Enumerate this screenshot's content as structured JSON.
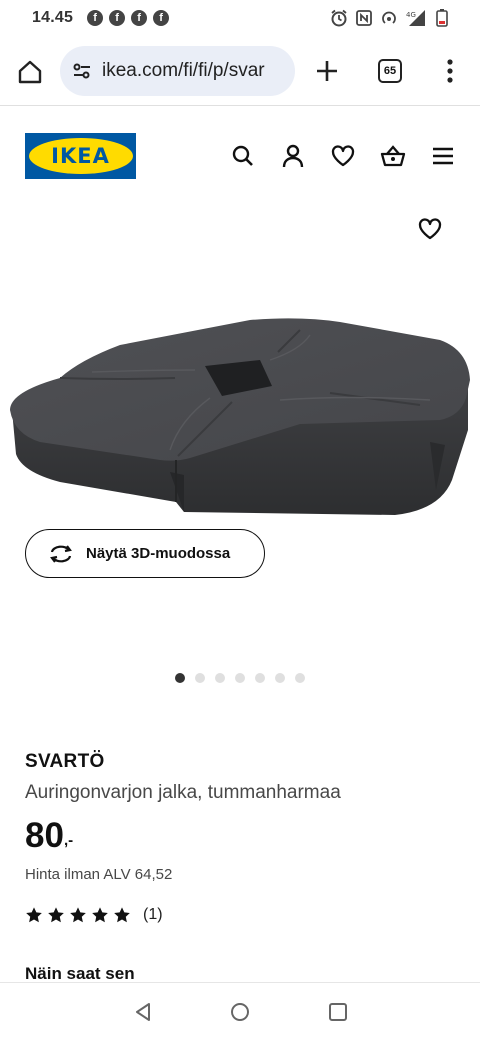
{
  "status_bar": {
    "time": "14.45",
    "notification_icons": [
      "facebook-icon",
      "facebook-icon",
      "facebook-icon",
      "facebook-icon"
    ],
    "facebook_glyph": "f",
    "network_label": "4G"
  },
  "browser": {
    "url": "ikea.com/fi/fi/p/svar",
    "tab_count": "65"
  },
  "header": {
    "logo_text": "IKEA",
    "logo_colors": {
      "blue": "#0058a3",
      "yellow": "#ffdb00"
    }
  },
  "product": {
    "view_3d_label": "Näytä 3D-muodossa",
    "carousel": {
      "total": 7,
      "active": 0
    },
    "name": "SVARTÖ",
    "description": "Auringonvarjon jalka, tummanharmaa",
    "price_main": "80",
    "price_suffix": ",-",
    "price_excl_vat": "Hinta ilman ALV 64,52",
    "rating": 5,
    "rating_max": 5,
    "review_count": "(1)",
    "delivery_heading": "Näin saat sen"
  },
  "colors": {
    "product": "#4a4b4e"
  }
}
